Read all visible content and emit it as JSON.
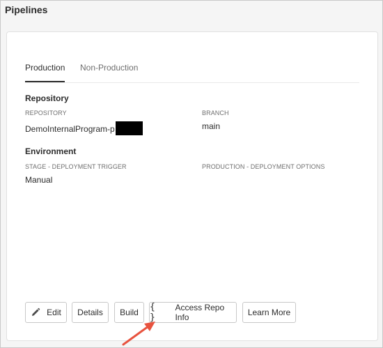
{
  "page": {
    "title": "Pipelines"
  },
  "tabs": [
    {
      "label": "Production",
      "active": true
    },
    {
      "label": "Non-Production",
      "active": false
    }
  ],
  "repository": {
    "heading": "Repository",
    "repository_label": "REPOSITORY",
    "repository_value": "DemoInternalProgram-p",
    "branch_label": "BRANCH",
    "branch_value": "main"
  },
  "environment": {
    "heading": "Environment",
    "trigger_label": "STAGE - DEPLOYMENT TRIGGER",
    "trigger_value": "Manual",
    "options_label": "PRODUCTION - DEPLOYMENT OPTIONS"
  },
  "actions": {
    "edit": "Edit",
    "details": "Details",
    "build": "Build",
    "access_repo_icon": "{ }",
    "access_repo": "Access Repo Info",
    "learn_more": "Learn More"
  },
  "icons": {
    "edit": "pencil-icon",
    "access_repo": "braces-icon",
    "annotation": "arrow-annotation"
  },
  "colors": {
    "accent_arrow": "#e8533f",
    "text": "#2c2c2c",
    "muted": "#6e6e6e"
  }
}
